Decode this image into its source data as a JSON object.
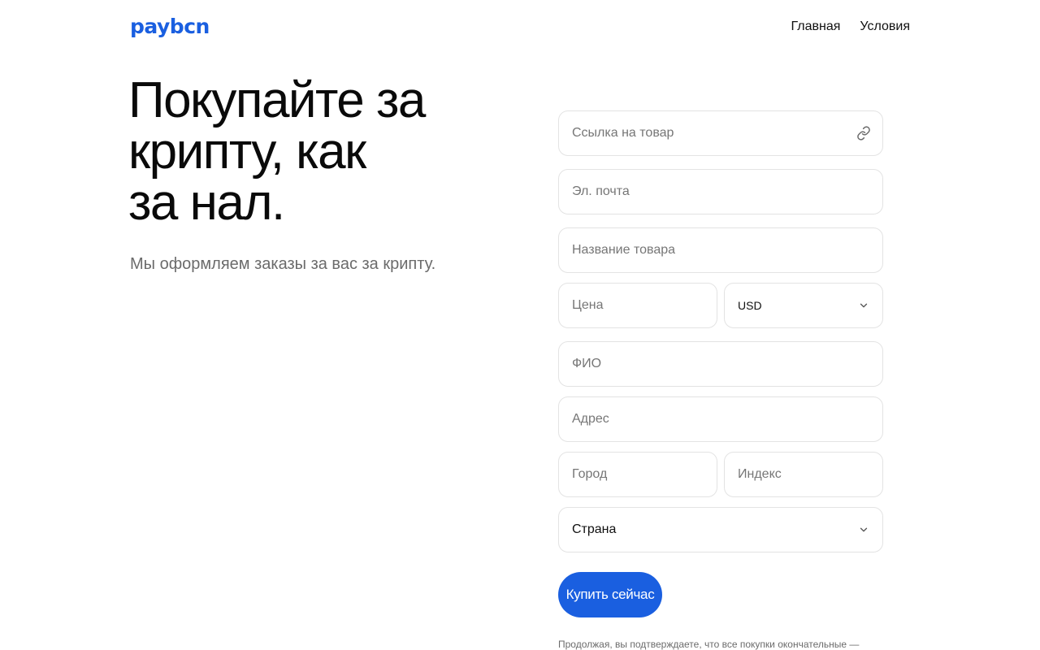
{
  "header": {
    "logo": "paybcn",
    "nav": [
      {
        "label": "Главная"
      },
      {
        "label": "Условия"
      }
    ]
  },
  "hero": {
    "title_lines": [
      "Покупайте за",
      "крипту, как",
      "за нал."
    ],
    "subtitle": "Мы оформляем заказы за вас за крипту."
  },
  "form": {
    "product_link": {
      "placeholder": "Ссылка на товар",
      "icon": "link-icon"
    },
    "email": {
      "placeholder": "Эл. почта"
    },
    "product_name": {
      "placeholder": "Название товара"
    },
    "price": {
      "placeholder": "Цена"
    },
    "currency": {
      "value": "USD",
      "icon": "chevron-down-icon"
    },
    "full_name": {
      "placeholder": "ФИО"
    },
    "address": {
      "placeholder": "Адрес"
    },
    "city": {
      "placeholder": "Город"
    },
    "postcode": {
      "placeholder": "Индекс"
    },
    "country": {
      "value": "Страна",
      "icon": "chevron-down-icon"
    },
    "submit_label": "Купить сейчас",
    "disclaimer": "Продолжая, вы подтверждаете, что все покупки окончательные —"
  },
  "colors": {
    "accent": "#1a5fe0",
    "border": "#e3e3e3",
    "muted_text": "#6b6b6b"
  }
}
